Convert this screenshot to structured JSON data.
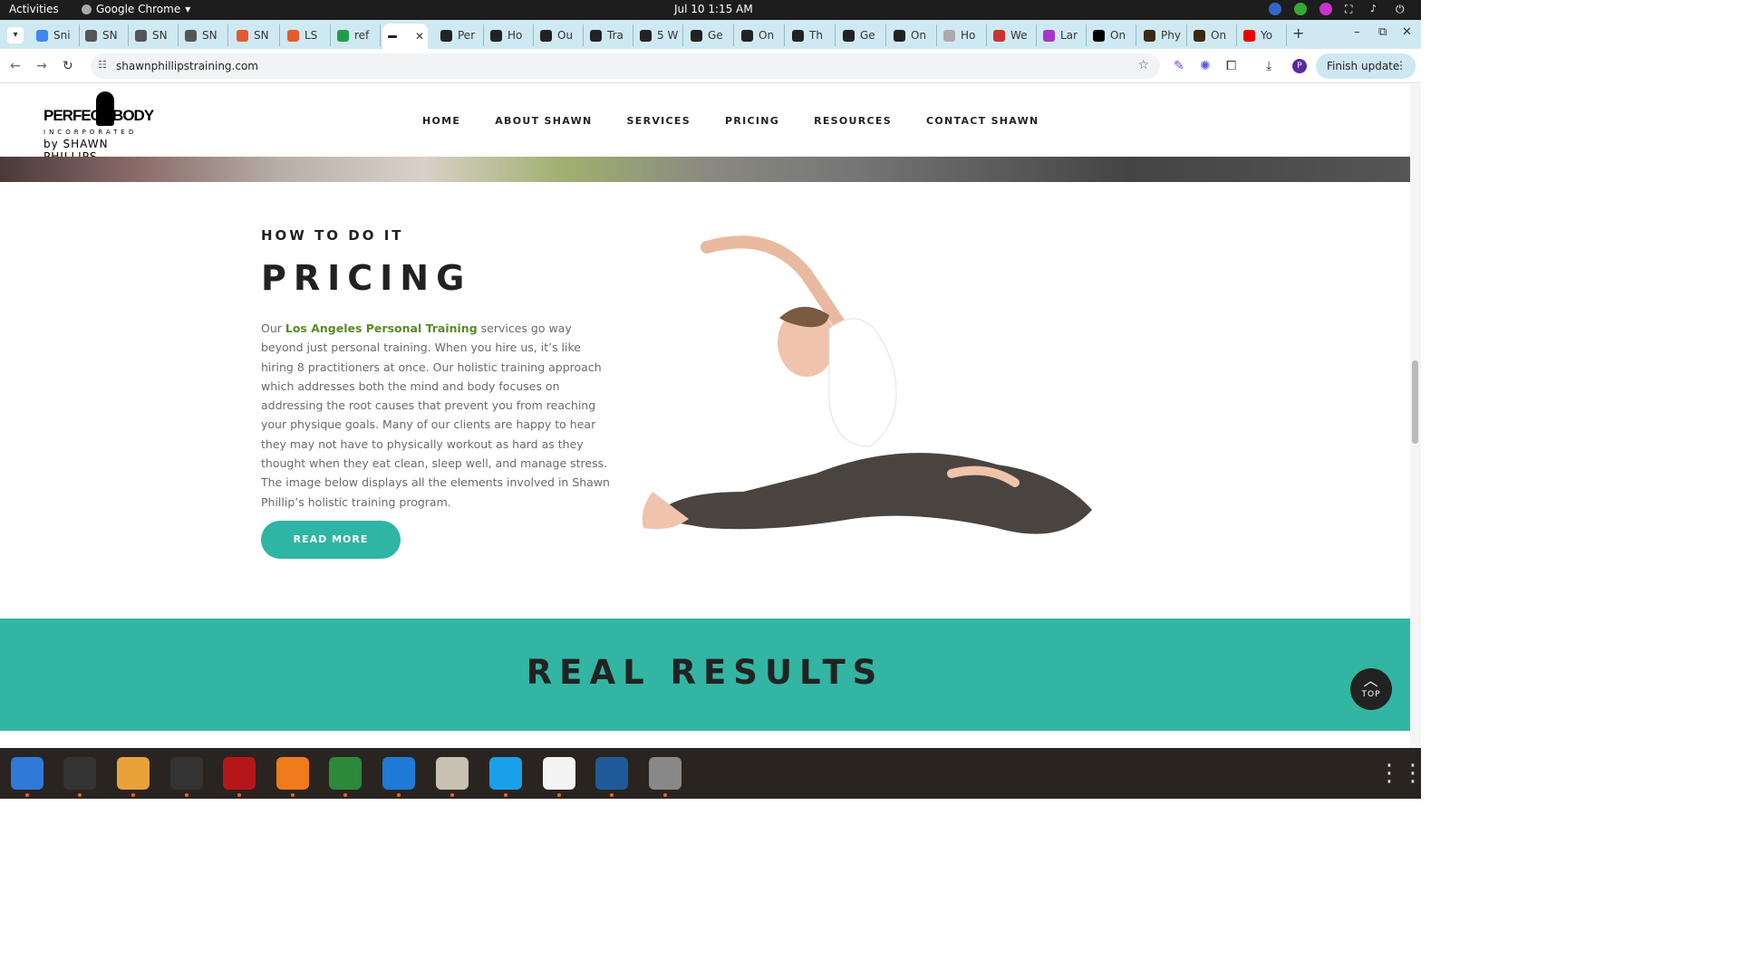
{
  "os": {
    "activities": "Activities",
    "app_name": "Google Chrome",
    "clock": "Jul 10  1:15 AM"
  },
  "browser": {
    "tabs": [
      {
        "label": "Sni",
        "color": "#4285f4"
      },
      {
        "label": "SN",
        "color": "#555"
      },
      {
        "label": "SN",
        "color": "#555"
      },
      {
        "label": "SN",
        "color": "#555"
      },
      {
        "label": "SN",
        "color": "#e45a2c"
      },
      {
        "label": "LS",
        "color": "#e45a2c"
      },
      {
        "label": "ref",
        "color": "#1e9e4a"
      },
      {
        "label": "Per",
        "color": "#222"
      },
      {
        "label": "Ho",
        "color": "#222"
      },
      {
        "label": "Ou",
        "color": "#222"
      },
      {
        "label": "Tra",
        "color": "#222"
      },
      {
        "label": "5 W",
        "color": "#222"
      },
      {
        "label": "Ge",
        "color": "#222"
      },
      {
        "label": "On",
        "color": "#222"
      },
      {
        "label": "Th",
        "color": "#222"
      },
      {
        "label": "Ge",
        "color": "#222"
      },
      {
        "label": "On",
        "color": "#222"
      },
      {
        "label": "Ho",
        "color": "#aaa"
      },
      {
        "label": "We",
        "color": "#c33"
      },
      {
        "label": "Lar",
        "color": "#a3c"
      },
      {
        "label": "On",
        "color": "#000"
      },
      {
        "label": "Phy",
        "color": "#3a2a10"
      },
      {
        "label": "On",
        "color": "#3a2a10"
      },
      {
        "label": "Yo",
        "color": "#e00"
      }
    ],
    "url": "shawnphillipstraining.com",
    "finish_update": "Finish update",
    "profile_initial": "P"
  },
  "site": {
    "logo": {
      "line1": "PERFECT BODY",
      "line2": "INCORPORATED",
      "line3": "by SHAWN PHILLIPS"
    },
    "nav": [
      "HOME",
      "ABOUT SHAWN",
      "SERVICES",
      "PRICING",
      "RESOURCES",
      "CONTACT SHAWN"
    ],
    "eyebrow": "HOW TO DO IT",
    "title": "PRICING",
    "body_before": "Our ",
    "body_link": "Los Angeles Personal Training",
    "body_after": " services go way beyond just personal training. When you hire us, it’s like hiring 8 practitioners at once. Our holistic training approach which addresses both the mind and body focuses on addressing the root causes that prevent you from reaching your physique goals. Many of our clients are happy to hear they may not have to physically workout as hard as they thought when they eat clean, sleep well, and manage stress. The image below displays all the elements involved in Shawn Phillip’s holistic training program.",
    "read_more": "READ MORE",
    "results_title": "REAL RESULTS",
    "top_button": "TOP"
  },
  "dock": [
    "thunderbird-icon",
    "terminal-icon",
    "calculator-icon",
    "system-monitor-icon",
    "filezilla-icon",
    "firefox-icon",
    "chrome-icon",
    "vscode-icon",
    "files-icon",
    "skype-icon",
    "text-editor-icon",
    "document-viewer-icon",
    "disks-icon",
    "app-grid-icon"
  ]
}
